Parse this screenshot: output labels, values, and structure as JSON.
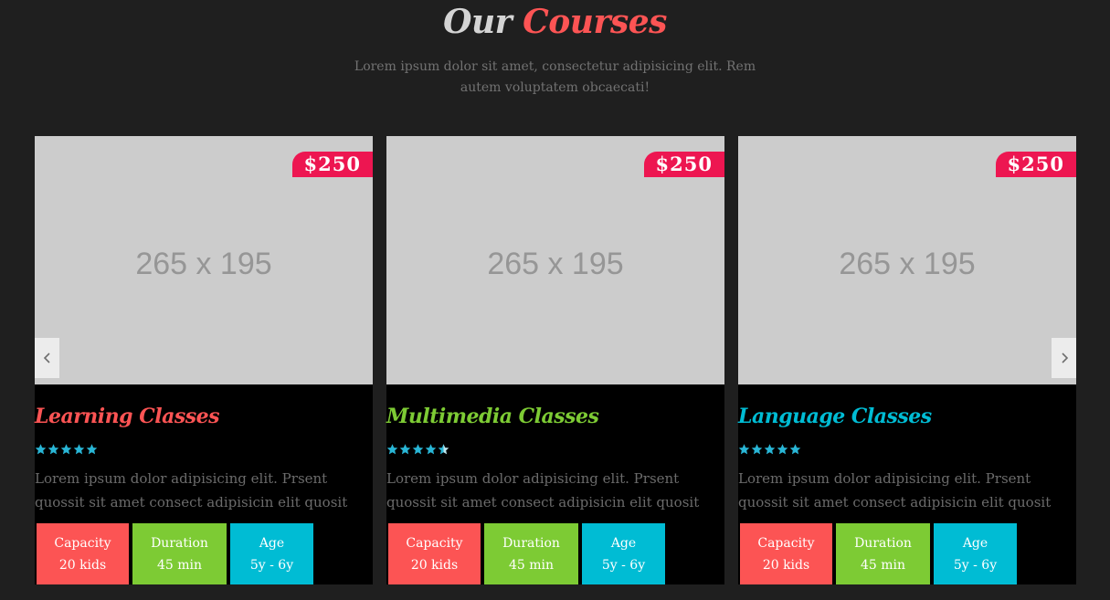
{
  "heading": {
    "part1": "Our",
    "part2": "Courses"
  },
  "subtitle": "Lorem ipsum dolor sit amet, consectetur adipisicing elit. Rem autem voluptatem obcaecati!",
  "colors": {
    "accent": "#fc5454",
    "green": "#7dcb34",
    "cyan": "#00bcd4",
    "price": "#ed1651",
    "star": "#29b6d6"
  },
  "courses": [
    {
      "image_placeholder": "265 x 195",
      "price": "$250",
      "title": "Learning Classes",
      "title_color": "#fc5454",
      "rating": 5,
      "description": "Lorem ipsum dolor adipisicing elit. Prsent quossit sit amet consect adipisicin elit quosit",
      "stats": [
        {
          "label": "Capacity",
          "value": "20 kids"
        },
        {
          "label": "Duration",
          "value": "45 min"
        },
        {
          "label": "Age",
          "value": "5y - 6y"
        }
      ]
    },
    {
      "image_placeholder": "265 x 195",
      "price": "$250",
      "title": "Multimedia Classes",
      "title_color": "#7dcb34",
      "rating": 4.5,
      "description": "Lorem ipsum dolor adipisicing elit. Prsent quossit sit amet consect adipisicin elit quosit",
      "stats": [
        {
          "label": "Capacity",
          "value": "20 kids"
        },
        {
          "label": "Duration",
          "value": "45 min"
        },
        {
          "label": "Age",
          "value": "5y - 6y"
        }
      ]
    },
    {
      "image_placeholder": "265 x 195",
      "price": "$250",
      "title": "Language Classes",
      "title_color": "#00bcd4",
      "rating": 5,
      "description": "Lorem ipsum dolor adipisicing elit. Prsent quossit sit amet consect adipisicin elit quosit",
      "stats": [
        {
          "label": "Capacity",
          "value": "20 kids"
        },
        {
          "label": "Duration",
          "value": "45 min"
        },
        {
          "label": "Age",
          "value": "5y - 6y"
        }
      ]
    }
  ],
  "nav": {
    "prev_icon": "chevron-left-icon",
    "next_icon": "chevron-right-icon"
  }
}
